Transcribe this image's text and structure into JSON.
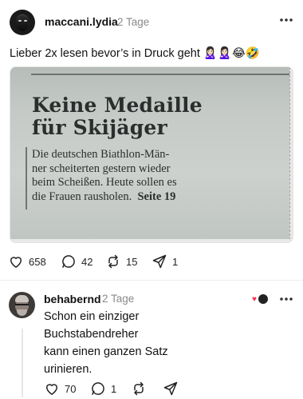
{
  "post": {
    "username": "maccani.lydia",
    "time": "2 Tage",
    "text": "Lieber 2x lesen bevor’s in Druck geht 🙎🏻‍♀️🙎🏻‍♀️😂🤣",
    "image": {
      "headline_line1": "Keine Medaille",
      "headline_line2": "für Skijäger",
      "body_line1": "Die deutschen Biathlon-Män-",
      "body_line2": "ner scheiterten gestern wieder",
      "body_line3": "beim Scheißen. Heute sollen es",
      "body_line4": "die Frauen rausholen.",
      "body_ref": "Seite 19"
    },
    "likes": "658",
    "replies": "42",
    "reposts": "15",
    "shares": "1"
  },
  "reply": {
    "username": "behabernd",
    "time": "2 Tage",
    "line1": "Schon ein einziger",
    "line2": "Buchstabendreher",
    "line3": "kann einen ganzen Satz",
    "line4": "urinieren.",
    "likes": "70",
    "replies": "1"
  },
  "icons": {
    "like": "heart-icon",
    "reply": "comment-icon",
    "repost": "repost-icon",
    "share": "send-icon",
    "more": "more-icon"
  },
  "colors": {
    "muted": "#8a8a8a",
    "heart_reaction": "#ff2d55"
  }
}
